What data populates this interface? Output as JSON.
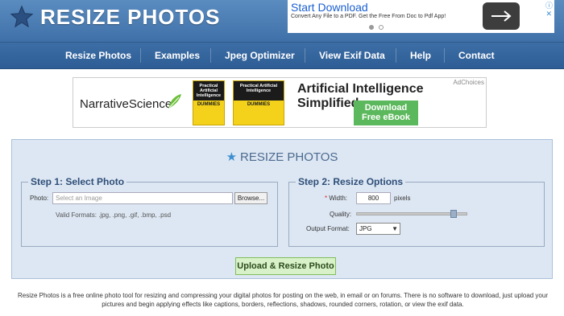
{
  "header": {
    "logo_text": "RESIZE PHOTOS",
    "ad": {
      "title": "Start Download",
      "subtitle": "Convert Any File to a PDF. Get the Free From Doc to Pdf App!"
    }
  },
  "nav": {
    "items": [
      "Resize Photos",
      "Examples",
      "Jpeg Optimizer",
      "View Exif Data",
      "Help",
      "Contact"
    ]
  },
  "banner_ad": {
    "brand": "NarrativeScience",
    "book_title": "Practical Artificial Intelligence",
    "book_subtitle": "DUMMIES",
    "headline": "Artificial Intelligence Simplified.",
    "button": "Download\nFree eBook",
    "adchoices": "AdChoices"
  },
  "form": {
    "title": "RESIZE PHOTOS",
    "step1": {
      "legend": "Step 1: Select Photo",
      "photo_label": "Photo:",
      "photo_placeholder": "Select an Image",
      "browse_label": "Browse...",
      "valid_formats": "Valid Formats: .jpg, .png, .gif, .bmp, .psd"
    },
    "step2": {
      "legend": "Step 2: Resize Options",
      "width_label": "Width:",
      "width_value": "800",
      "width_unit": "pixels",
      "quality_label": "Quality:",
      "quality_level": 0.9,
      "format_label": "Output Format:",
      "format_value": "JPG"
    },
    "submit_label": "Upload & Resize Photo"
  },
  "description": "Resize Photos is a free online photo tool for resizing and compressing your digital photos for posting on the web, in email or on forums. There is no software to download, just upload your pictures and begin applying effects like captions, borders, reflections, shadows, rounded corners, rotation, or view the exif data.",
  "colors": {
    "header": "#4a7eb5",
    "nav": "#356598",
    "panel_bg": "#dde7f3",
    "accent_star": "#3d8fcf",
    "submit_bg": "#d8f1c9"
  }
}
